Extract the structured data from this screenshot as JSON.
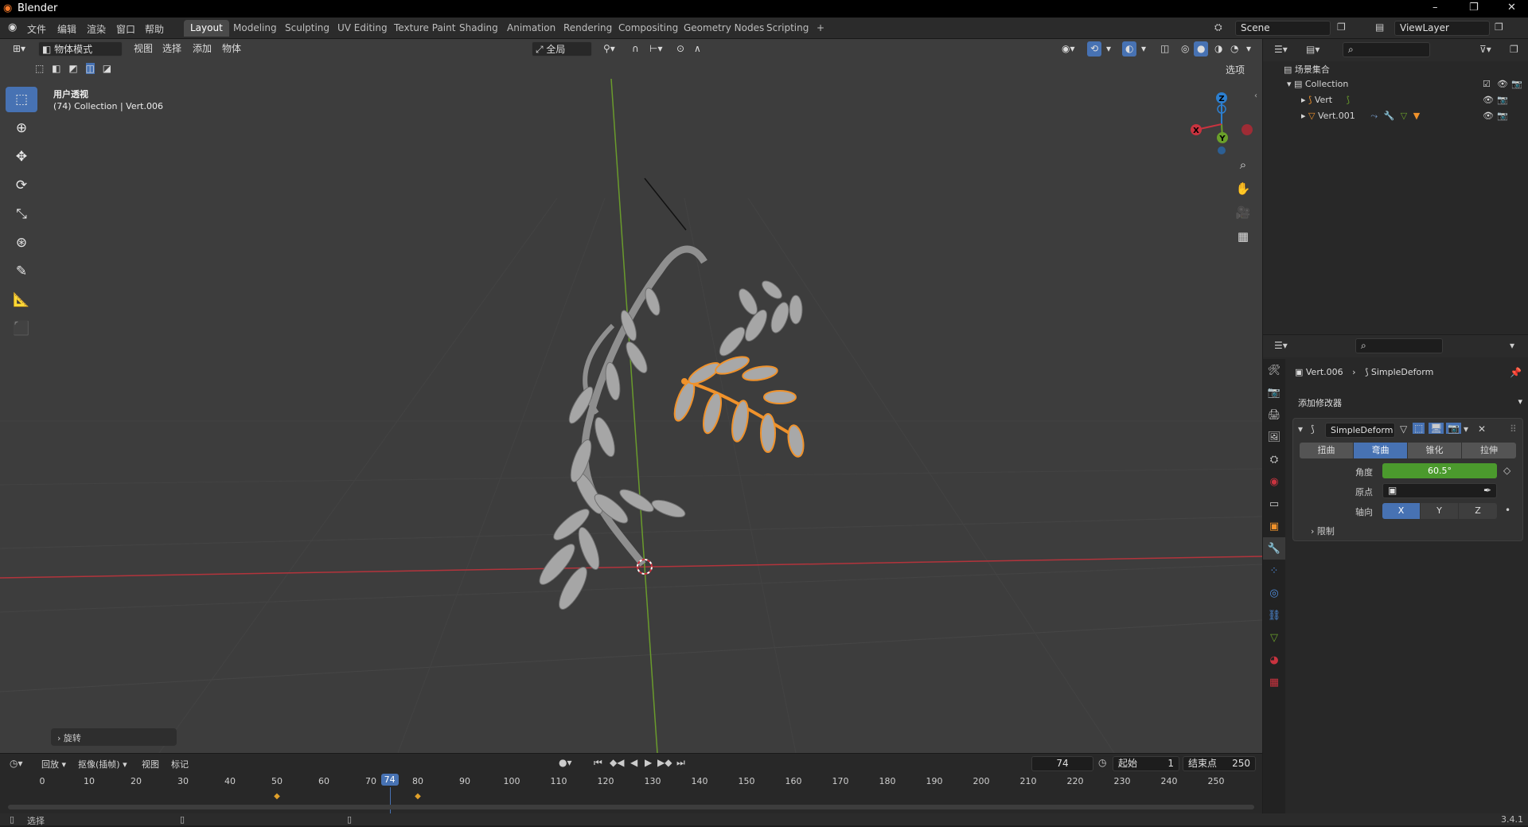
{
  "window": {
    "title": "Blender",
    "controls": [
      "–",
      "❐",
      "✕"
    ]
  },
  "menu": [
    "文件",
    "编辑",
    "渲染",
    "窗口",
    "帮助"
  ],
  "workspaces": [
    {
      "label": "Layout",
      "active": true
    },
    {
      "label": "Modeling"
    },
    {
      "label": "Sculpting"
    },
    {
      "label": "UV Editing"
    },
    {
      "label": "Texture Paint"
    },
    {
      "label": "Shading"
    },
    {
      "label": "Animation"
    },
    {
      "label": "Rendering"
    },
    {
      "label": "Compositing"
    },
    {
      "label": "Geometry Nodes"
    },
    {
      "label": "Scripting"
    },
    {
      "label": "+"
    }
  ],
  "scene": {
    "name": "Scene",
    "view_layer": "ViewLayer"
  },
  "viewport": {
    "mode": "物体模式",
    "menus": [
      "视图",
      "选择",
      "添加",
      "物体"
    ],
    "transform_orientation": "全局",
    "options_label": "选项",
    "view_name": "用户透视",
    "collection_info": "(74) Collection | Vert.006",
    "gizmo": {
      "z": "Z",
      "y": "Y",
      "x": "X"
    },
    "last_operator": "旋转"
  },
  "outliner": {
    "root": "场景集合",
    "collection": "Collection",
    "objects": [
      "Vert",
      "Vert.001"
    ]
  },
  "properties": {
    "breadcrumb_object": "Vert.006",
    "breadcrumb_modifier": "SimpleDeform",
    "add_modifier": "添加修改器",
    "modifier_name": "SimpleDeform",
    "deform_modes": [
      {
        "label": "扭曲"
      },
      {
        "label": "弯曲",
        "active": true
      },
      {
        "label": "锥化"
      },
      {
        "label": "拉伸"
      }
    ],
    "angle_label": "角度",
    "angle_value": "60.5°",
    "origin_label": "原点",
    "axis_label": "轴向",
    "axes": [
      {
        "label": "X",
        "active": true
      },
      {
        "label": "Y"
      },
      {
        "label": "Z"
      }
    ],
    "limits_label": "限制"
  },
  "timeline": {
    "menus": [
      "回放",
      "抠像(插帧)",
      "视图",
      "标记"
    ],
    "current_frame": "74",
    "start_label": "起始",
    "start": "1",
    "end_label": "结束点",
    "end": "250",
    "ticks": [
      "0",
      "10",
      "20",
      "30",
      "40",
      "50",
      "60",
      "70",
      "80",
      "90",
      "100",
      "110",
      "120",
      "130",
      "140",
      "150",
      "160",
      "170",
      "180",
      "190",
      "200",
      "210",
      "220",
      "230",
      "240",
      "250"
    ],
    "keyframes": [
      50,
      80
    ]
  },
  "status": {
    "left": "选择",
    "version": "3.4.1"
  },
  "colors": {
    "accent": "#4772b3",
    "selection": "#f0922b",
    "angle_field": "#4b9a2d",
    "x_axis": "#c9333f",
    "y_axis": "#6aa02a",
    "z_axis": "#2c7fd0"
  }
}
